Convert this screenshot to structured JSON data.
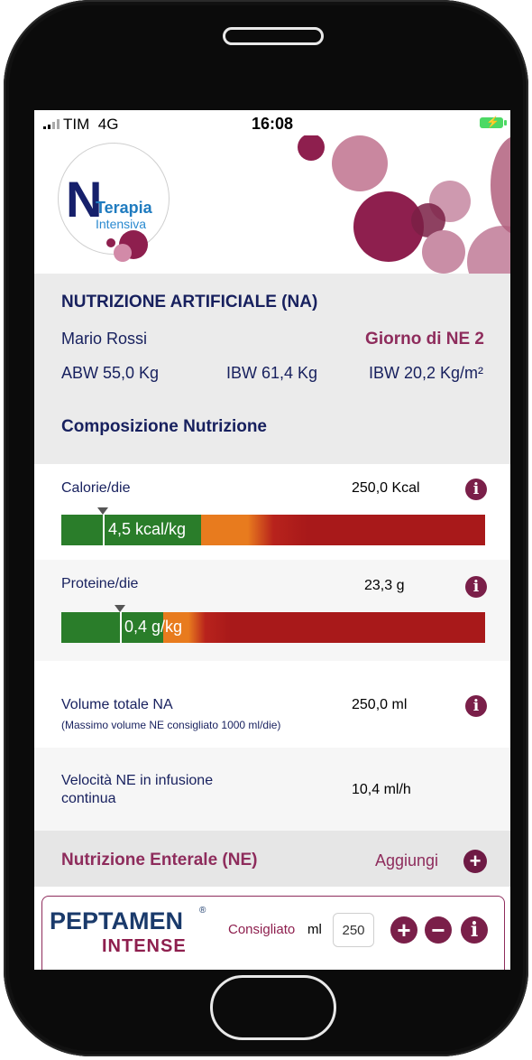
{
  "status": {
    "carrier": "TIM",
    "network": "4G",
    "time": "16:08"
  },
  "logo": {
    "letter": "N",
    "line1": "Terapia",
    "line2": "Intensiva"
  },
  "nutrition": {
    "title": "NUTRIZIONE ARTIFICIALE (NA)",
    "patient": "Mario Rossi",
    "day": "Giorno di NE 2",
    "abw": "ABW 55,0 Kg",
    "ibw": "IBW 61,4 Kg",
    "bmi": "IBW 20,2 Kg/m²",
    "composition_title": "Composizione Nutrizione"
  },
  "calories": {
    "label": "Calorie/die",
    "value": "250,0 Kcal",
    "bar_label": "4,5 kcal/kg"
  },
  "protein": {
    "label": "Proteine/die",
    "value": "23,3 g",
    "bar_label": "0,4 g/kg"
  },
  "volume": {
    "label": "Volume totale NA",
    "note": "(Massimo volume NE consigliato 1000 ml/die)",
    "value": "250,0 ml"
  },
  "velocity": {
    "label_line1": "Velocità NE in infusione",
    "label_line2": "continua",
    "value": "10,4 ml/h"
  },
  "enteral": {
    "title": "Nutrizione Enterale (NE)",
    "add_label": "Aggiungi"
  },
  "product": {
    "brand_line1": "PEPTAMEN",
    "brand_line2": "INTENSE",
    "registered": "®",
    "recommended": "Consigliato",
    "unit": "ml",
    "ml_value": "250"
  },
  "icons": {
    "info": "info-icon",
    "plus": "plus-icon",
    "minus": "minus-icon"
  },
  "colors": {
    "accent": "#7a1f49",
    "title_navy": "#17205e",
    "bar_green": "#2a7d2a",
    "bar_orange": "#e87b1e",
    "bar_red": "#a8191a"
  }
}
